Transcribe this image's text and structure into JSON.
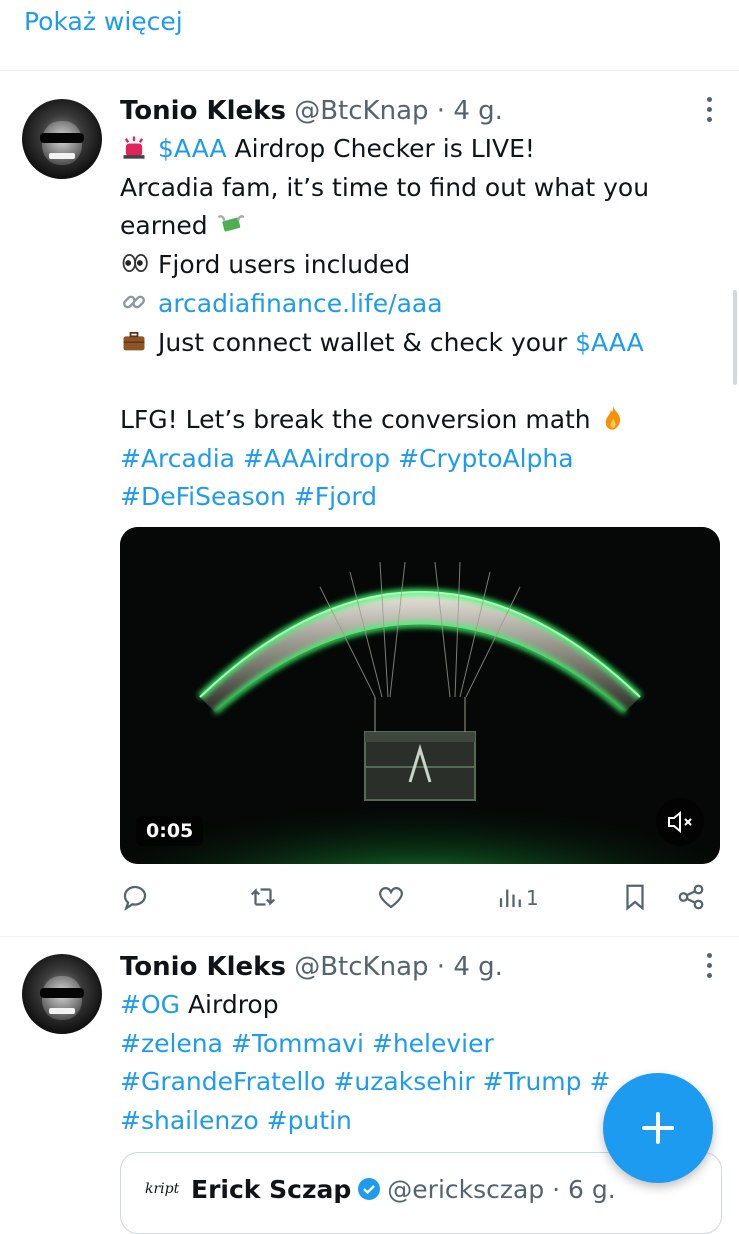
{
  "show_more": "Pokaż więcej",
  "tweets": [
    {
      "name": "Tonio Kleks",
      "handle": "@BtcKnap",
      "sep": " · ",
      "time": "4 g.",
      "lines": [
        {
          "emoji": "siren-emoji",
          "parts": [
            {
              "t": "$AAA",
              "link": true
            },
            {
              "t": " Airdrop Checker is LIVE!"
            }
          ]
        },
        {
          "parts": [
            {
              "t": "Arcadia fam, it’s time to find out what you"
            }
          ]
        },
        {
          "parts": [
            {
              "t": "earned "
            }
          ],
          "trail_emoji": "money-wings-emoji"
        },
        {
          "emoji": "eyes-emoji",
          "parts": [
            {
              "t": "Fjord users included"
            }
          ]
        },
        {
          "emoji": "link-emoji",
          "parts": [
            {
              "t": "arcadiafinance.life/aaa",
              "link": true
            }
          ]
        },
        {
          "emoji": "briefcase-emoji",
          "parts": [
            {
              "t": "Just connect wallet & check your "
            },
            {
              "t": "$AAA",
              "link": true
            }
          ]
        },
        {
          "parts": [
            {
              "t": ""
            }
          ]
        },
        {
          "parts": [
            {
              "t": "LFG! Let’s break the conversion math "
            }
          ],
          "trail_emoji": "fire-emoji"
        },
        {
          "parts": [
            {
              "t": "#Arcadia #AAAirdrop #CryptoAlpha",
              "link": true
            }
          ]
        },
        {
          "parts": [
            {
              "t": "#DeFiSeason #Fjord",
              "link": true
            }
          ]
        }
      ],
      "video_time": "0:05",
      "actions": {
        "reply": "reply-icon",
        "retweet": "retweet-icon",
        "like": "like-icon",
        "views": "1",
        "bookmark": "bookmark-icon",
        "share": "share-icon"
      }
    },
    {
      "name": "Tonio Kleks",
      "handle": "@BtcKnap",
      "sep": " · ",
      "time": "4 g.",
      "lines": [
        {
          "parts": [
            {
              "t": "#OG",
              "link": true
            },
            {
              "t": " Airdrop"
            }
          ]
        },
        {
          "parts": [
            {
              "t": "#zelena #Tommavi #helevier",
              "link": true
            }
          ]
        },
        {
          "parts": [
            {
              "t": "#GrandeFratello #uzaksehir #Trump #",
              "link": true
            }
          ]
        },
        {
          "parts": [
            {
              "t": "#shailenzo #putin",
              "link": true
            }
          ]
        }
      ],
      "quote": {
        "logo": "kript",
        "name": "Erick Sczap",
        "handle": "@ericksczap",
        "time": "6 g."
      }
    }
  ],
  "colors": {
    "accent": "#1d9bf0",
    "text": "#0f1419",
    "muted": "#536471",
    "neon": "#3dff6a"
  }
}
